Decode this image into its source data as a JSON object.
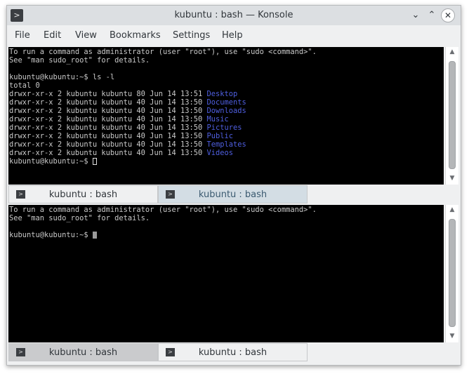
{
  "window": {
    "title": "kubuntu : bash — Konsole",
    "buttons": {
      "minimize": "⌄",
      "maximize": "⌃",
      "close": "✕"
    }
  },
  "menu": [
    "File",
    "Edit",
    "View",
    "Bookmarks",
    "Settings",
    "Help"
  ],
  "top_pane": {
    "lines": [
      "To run a command as administrator (user \"root\"), use \"sudo <command>\".",
      "See \"man sudo_root\" for details.",
      "",
      "kubuntu@kubuntu:~$ ls -l",
      "total 0"
    ],
    "listing": [
      {
        "meta": "drwxr-xr-x 2 kubuntu kubuntu 80 Jun 14 13:51 ",
        "name": "Desktop"
      },
      {
        "meta": "drwxr-xr-x 2 kubuntu kubuntu 40 Jun 14 13:50 ",
        "name": "Documents"
      },
      {
        "meta": "drwxr-xr-x 2 kubuntu kubuntu 40 Jun 14 13:50 ",
        "name": "Downloads"
      },
      {
        "meta": "drwxr-xr-x 2 kubuntu kubuntu 40 Jun 14 13:50 ",
        "name": "Music"
      },
      {
        "meta": "drwxr-xr-x 2 kubuntu kubuntu 40 Jun 14 13:50 ",
        "name": "Pictures"
      },
      {
        "meta": "drwxr-xr-x 2 kubuntu kubuntu 40 Jun 14 13:50 ",
        "name": "Public"
      },
      {
        "meta": "drwxr-xr-x 2 kubuntu kubuntu 40 Jun 14 13:50 ",
        "name": "Templates"
      },
      {
        "meta": "drwxr-xr-x 2 kubuntu kubuntu 40 Jun 14 13:50 ",
        "name": "Videos"
      }
    ],
    "prompt": "kubuntu@kubuntu:~$ ",
    "tabs": [
      "kubuntu : bash",
      "kubuntu : bash"
    ]
  },
  "bottom_pane": {
    "lines": [
      "To run a command as administrator (user \"root\"), use \"sudo <command>\".",
      "See \"man sudo_root\" for details.",
      ""
    ],
    "prompt": "kubuntu@kubuntu:~$ ",
    "tabs": [
      "kubuntu : bash",
      "kubuntu : bash"
    ]
  },
  "colors": {
    "terminal_bg": "#000000",
    "terminal_fg": "#c9c9c9",
    "directory": "#4f5fe0",
    "active_tab_bg": "#d3dde4",
    "active_tab_fg": "#3b5a70",
    "inactive_tab_bg": "#cacbcd"
  },
  "icons": {
    "app": "terminal-prompt-icon",
    "tab": "terminal-prompt-icon"
  }
}
